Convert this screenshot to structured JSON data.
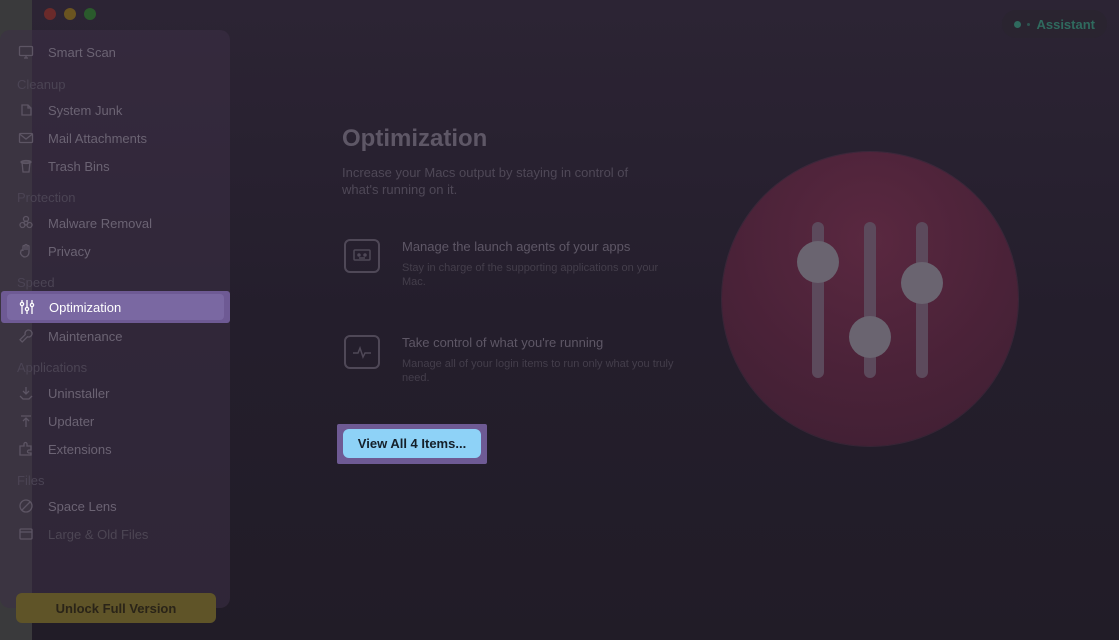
{
  "window": {
    "assistant_label": "Assistant"
  },
  "sidebar": {
    "smart_scan": "Smart Scan",
    "sections": {
      "cleanup": "Cleanup",
      "protection": "Protection",
      "speed": "Speed",
      "applications": "Applications",
      "files": "Files"
    },
    "items": {
      "system_junk": "System Junk",
      "mail_attachments": "Mail Attachments",
      "trash_bins": "Trash Bins",
      "malware_removal": "Malware Removal",
      "privacy": "Privacy",
      "optimization": "Optimization",
      "maintenance": "Maintenance",
      "uninstaller": "Uninstaller",
      "updater": "Updater",
      "extensions": "Extensions",
      "space_lens": "Space Lens",
      "large_old_files": "Large & Old Files"
    },
    "unlock_label": "Unlock Full Version"
  },
  "main": {
    "title": "Optimization",
    "subtitle": "Increase your Macs output by staying in control of what's running on it.",
    "features": [
      {
        "heading": "Manage the launch agents of your apps",
        "description": "Stay in charge of the supporting applications on your Mac."
      },
      {
        "heading": "Take control of what you're running",
        "description": "Manage all of your login items to run only what you truly need."
      }
    ],
    "view_button_label": "View All 4 Items..."
  },
  "hero": {
    "icon": "sliders-icon",
    "colors": {
      "circle": "#4a2238",
      "track": "#5a4a5a",
      "knob": "#6a6470"
    }
  },
  "colors": {
    "accent": "#6e5a94",
    "button": "#8ed2f7",
    "unlock": "#5f5428"
  }
}
